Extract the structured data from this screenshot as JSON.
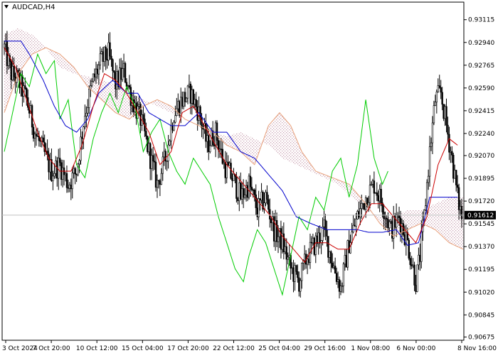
{
  "chart_data": {
    "type": "candlestick",
    "title": "AUDCAD,H4",
    "symbol": "AUDCAD",
    "timeframe": "H4",
    "current_price": 0.91612,
    "ylim": [
      0.9065,
      0.9325
    ],
    "y_ticks": [
      "0.93115",
      "0.92940",
      "0.92765",
      "0.92590",
      "0.92415",
      "0.92240",
      "0.92070",
      "0.91895",
      "0.91720",
      "0.91545",
      "0.91370",
      "0.91195",
      "0.91020",
      "0.90845",
      "0.90675"
    ],
    "x_ticks": [
      "3 Oct 2024",
      "7 Oct 20:00",
      "10 Oct 12:00",
      "15 Oct 04:00",
      "17 Oct 20:00",
      "22 Oct 12:00",
      "25 Oct 04:00",
      "29 Oct 16:00",
      "1 Nov 08:00",
      "6 Nov 00:00",
      "8 Nov 16:00"
    ],
    "colors": {
      "candle": "#000000",
      "tenkan": "#cc0000",
      "kijun": "#0000cc",
      "chikou": "#00cc00",
      "senkou_a": "#e8a07a",
      "senkou_b": "#b8a0d0",
      "grid": "#c0c0c0"
    },
    "candle_anchors": [
      [
        0,
        0.929
      ],
      [
        5,
        0.927
      ],
      [
        10,
        0.9265
      ],
      [
        16,
        0.925
      ],
      [
        22,
        0.9225
      ],
      [
        28,
        0.921
      ],
      [
        34,
        0.9195
      ],
      [
        40,
        0.92
      ],
      [
        46,
        0.9185
      ],
      [
        52,
        0.9195
      ],
      [
        58,
        0.924
      ],
      [
        64,
        0.9265
      ],
      [
        70,
        0.928
      ],
      [
        75,
        0.9285
      ],
      [
        80,
        0.9262
      ],
      [
        86,
        0.9272
      ],
      [
        92,
        0.925
      ],
      [
        98,
        0.9235
      ],
      [
        104,
        0.921
      ],
      [
        110,
        0.9185
      ],
      [
        116,
        0.9205
      ],
      [
        122,
        0.924
      ],
      [
        128,
        0.925
      ],
      [
        134,
        0.9255
      ],
      [
        140,
        0.924
      ],
      [
        146,
        0.9215
      ],
      [
        152,
        0.9225
      ],
      [
        158,
        0.92
      ],
      [
        164,
        0.919
      ],
      [
        170,
        0.9175
      ],
      [
        176,
        0.9185
      ],
      [
        182,
        0.9165
      ],
      [
        188,
        0.9175
      ],
      [
        194,
        0.915
      ],
      [
        200,
        0.914
      ],
      [
        206,
        0.912
      ],
      [
        212,
        0.911
      ],
      [
        218,
        0.913
      ],
      [
        224,
        0.914
      ],
      [
        230,
        0.915
      ],
      [
        236,
        0.9125
      ],
      [
        242,
        0.9105
      ],
      [
        248,
        0.914
      ],
      [
        254,
        0.916
      ],
      [
        260,
        0.9175
      ],
      [
        266,
        0.9185
      ],
      [
        272,
        0.917
      ],
      [
        278,
        0.915
      ],
      [
        284,
        0.916
      ],
      [
        290,
        0.914
      ],
      [
        296,
        0.911
      ],
      [
        299,
        0.913
      ],
      [
        302,
        0.916
      ],
      [
        306,
        0.921
      ],
      [
        310,
        0.925
      ],
      [
        314,
        0.9255
      ],
      [
        318,
        0.923
      ],
      [
        322,
        0.9205
      ],
      [
        326,
        0.9175
      ],
      [
        329,
        0.916
      ]
    ],
    "tenkan_anchors": [
      [
        0,
        0.929
      ],
      [
        8,
        0.9275
      ],
      [
        16,
        0.925
      ],
      [
        24,
        0.9225
      ],
      [
        32,
        0.9205
      ],
      [
        40,
        0.9195
      ],
      [
        48,
        0.9195
      ],
      [
        56,
        0.9215
      ],
      [
        64,
        0.9245
      ],
      [
        72,
        0.927
      ],
      [
        80,
        0.9265
      ],
      [
        88,
        0.9255
      ],
      [
        96,
        0.924
      ],
      [
        104,
        0.9225
      ],
      [
        112,
        0.92
      ],
      [
        120,
        0.921
      ],
      [
        128,
        0.924
      ],
      [
        136,
        0.9245
      ],
      [
        144,
        0.923
      ],
      [
        152,
        0.9215
      ],
      [
        160,
        0.92
      ],
      [
        168,
        0.919
      ],
      [
        176,
        0.918
      ],
      [
        184,
        0.917
      ],
      [
        192,
        0.916
      ],
      [
        200,
        0.9145
      ],
      [
        208,
        0.9135
      ],
      [
        216,
        0.9125
      ],
      [
        224,
        0.914
      ],
      [
        232,
        0.914
      ],
      [
        240,
        0.9135
      ],
      [
        248,
        0.9135
      ],
      [
        256,
        0.9155
      ],
      [
        264,
        0.917
      ],
      [
        272,
        0.917
      ],
      [
        280,
        0.916
      ],
      [
        288,
        0.915
      ],
      [
        296,
        0.914
      ],
      [
        304,
        0.916
      ],
      [
        312,
        0.92
      ],
      [
        320,
        0.922
      ],
      [
        326,
        0.9215
      ]
    ],
    "kijun_anchors": [
      [
        0,
        0.9295
      ],
      [
        12,
        0.9295
      ],
      [
        18,
        0.9285
      ],
      [
        28,
        0.9265
      ],
      [
        36,
        0.9245
      ],
      [
        44,
        0.923
      ],
      [
        52,
        0.9225
      ],
      [
        60,
        0.9235
      ],
      [
        68,
        0.9255
      ],
      [
        78,
        0.9265
      ],
      [
        88,
        0.9255
      ],
      [
        96,
        0.9255
      ],
      [
        104,
        0.924
      ],
      [
        112,
        0.9235
      ],
      [
        120,
        0.923
      ],
      [
        130,
        0.923
      ],
      [
        140,
        0.924
      ],
      [
        150,
        0.9225
      ],
      [
        160,
        0.9225
      ],
      [
        170,
        0.921
      ],
      [
        180,
        0.9205
      ],
      [
        192,
        0.919
      ],
      [
        200,
        0.918
      ],
      [
        210,
        0.916
      ],
      [
        220,
        0.9155
      ],
      [
        232,
        0.915
      ],
      [
        244,
        0.915
      ],
      [
        254,
        0.915
      ],
      [
        262,
        0.9148
      ],
      [
        272,
        0.9148
      ],
      [
        282,
        0.915
      ],
      [
        290,
        0.9138
      ],
      [
        298,
        0.914
      ],
      [
        306,
        0.9175
      ],
      [
        316,
        0.9175
      ],
      [
        326,
        0.9175
      ]
    ],
    "chikou_anchors": [
      [
        0,
        0.921
      ],
      [
        6,
        0.924
      ],
      [
        12,
        0.927
      ],
      [
        18,
        0.926
      ],
      [
        24,
        0.9285
      ],
      [
        30,
        0.927
      ],
      [
        36,
        0.928
      ],
      [
        40,
        0.9235
      ],
      [
        46,
        0.925
      ],
      [
        52,
        0.92
      ],
      [
        58,
        0.919
      ],
      [
        64,
        0.922
      ],
      [
        70,
        0.924
      ],
      [
        76,
        0.9255
      ],
      [
        82,
        0.924
      ],
      [
        88,
        0.926
      ],
      [
        94,
        0.9245
      ],
      [
        100,
        0.921
      ],
      [
        106,
        0.9225
      ],
      [
        112,
        0.9235
      ],
      [
        118,
        0.921
      ],
      [
        124,
        0.9195
      ],
      [
        130,
        0.9185
      ],
      [
        136,
        0.9205
      ],
      [
        142,
        0.9195
      ],
      [
        148,
        0.9185
      ],
      [
        154,
        0.916
      ],
      [
        160,
        0.914
      ],
      [
        166,
        0.912
      ],
      [
        172,
        0.911
      ],
      [
        176,
        0.913
      ],
      [
        182,
        0.915
      ],
      [
        188,
        0.914
      ],
      [
        194,
        0.912
      ],
      [
        200,
        0.91
      ],
      [
        206,
        0.913
      ],
      [
        212,
        0.916
      ],
      [
        218,
        0.915
      ],
      [
        224,
        0.9175
      ],
      [
        230,
        0.9165
      ],
      [
        236,
        0.9195
      ],
      [
        242,
        0.9205
      ],
      [
        248,
        0.9175
      ],
      [
        254,
        0.92
      ],
      [
        260,
        0.925
      ],
      [
        266,
        0.9205
      ],
      [
        272,
        0.9185
      ],
      [
        276,
        0.9195
      ]
    ],
    "senkou_a_anchors": [
      [
        0,
        0.924
      ],
      [
        10,
        0.927
      ],
      [
        20,
        0.9285
      ],
      [
        30,
        0.929
      ],
      [
        40,
        0.9285
      ],
      [
        50,
        0.9275
      ],
      [
        60,
        0.926
      ],
      [
        70,
        0.925
      ],
      [
        80,
        0.924
      ],
      [
        90,
        0.9235
      ],
      [
        100,
        0.9245
      ],
      [
        110,
        0.925
      ],
      [
        120,
        0.9245
      ],
      [
        130,
        0.9235
      ],
      [
        140,
        0.923
      ],
      [
        150,
        0.9225
      ],
      [
        160,
        0.9215
      ],
      [
        170,
        0.921
      ],
      [
        180,
        0.92
      ],
      [
        190,
        0.923
      ],
      [
        198,
        0.924
      ],
      [
        206,
        0.923
      ],
      [
        214,
        0.921
      ],
      [
        224,
        0.9195
      ],
      [
        236,
        0.919
      ],
      [
        248,
        0.9185
      ],
      [
        260,
        0.917
      ],
      [
        270,
        0.9155
      ],
      [
        280,
        0.9145
      ],
      [
        290,
        0.915
      ],
      [
        300,
        0.9155
      ],
      [
        310,
        0.915
      ],
      [
        320,
        0.914
      ],
      [
        330,
        0.9135
      ],
      [
        345,
        0.913
      ]
    ],
    "senkou_b_anchors": [
      [
        0,
        0.93
      ],
      [
        10,
        0.9305
      ],
      [
        20,
        0.93
      ],
      [
        30,
        0.929
      ],
      [
        40,
        0.9275
      ],
      [
        50,
        0.927
      ],
      [
        60,
        0.9268
      ],
      [
        70,
        0.9265
      ],
      [
        80,
        0.9262
      ],
      [
        90,
        0.9255
      ],
      [
        100,
        0.925
      ],
      [
        110,
        0.9245
      ],
      [
        120,
        0.924
      ],
      [
        130,
        0.9235
      ],
      [
        140,
        0.923
      ],
      [
        150,
        0.9225
      ],
      [
        160,
        0.9222
      ],
      [
        170,
        0.9225
      ],
      [
        180,
        0.922
      ],
      [
        190,
        0.9215
      ],
      [
        200,
        0.9205
      ],
      [
        210,
        0.92
      ],
      [
        220,
        0.9195
      ],
      [
        230,
        0.919
      ],
      [
        240,
        0.9185
      ],
      [
        250,
        0.9175
      ],
      [
        260,
        0.9165
      ],
      [
        270,
        0.916
      ],
      [
        280,
        0.916
      ],
      [
        290,
        0.9165
      ],
      [
        300,
        0.9165
      ],
      [
        310,
        0.917
      ],
      [
        320,
        0.9175
      ],
      [
        330,
        0.9175
      ],
      [
        345,
        0.9175
      ]
    ]
  }
}
